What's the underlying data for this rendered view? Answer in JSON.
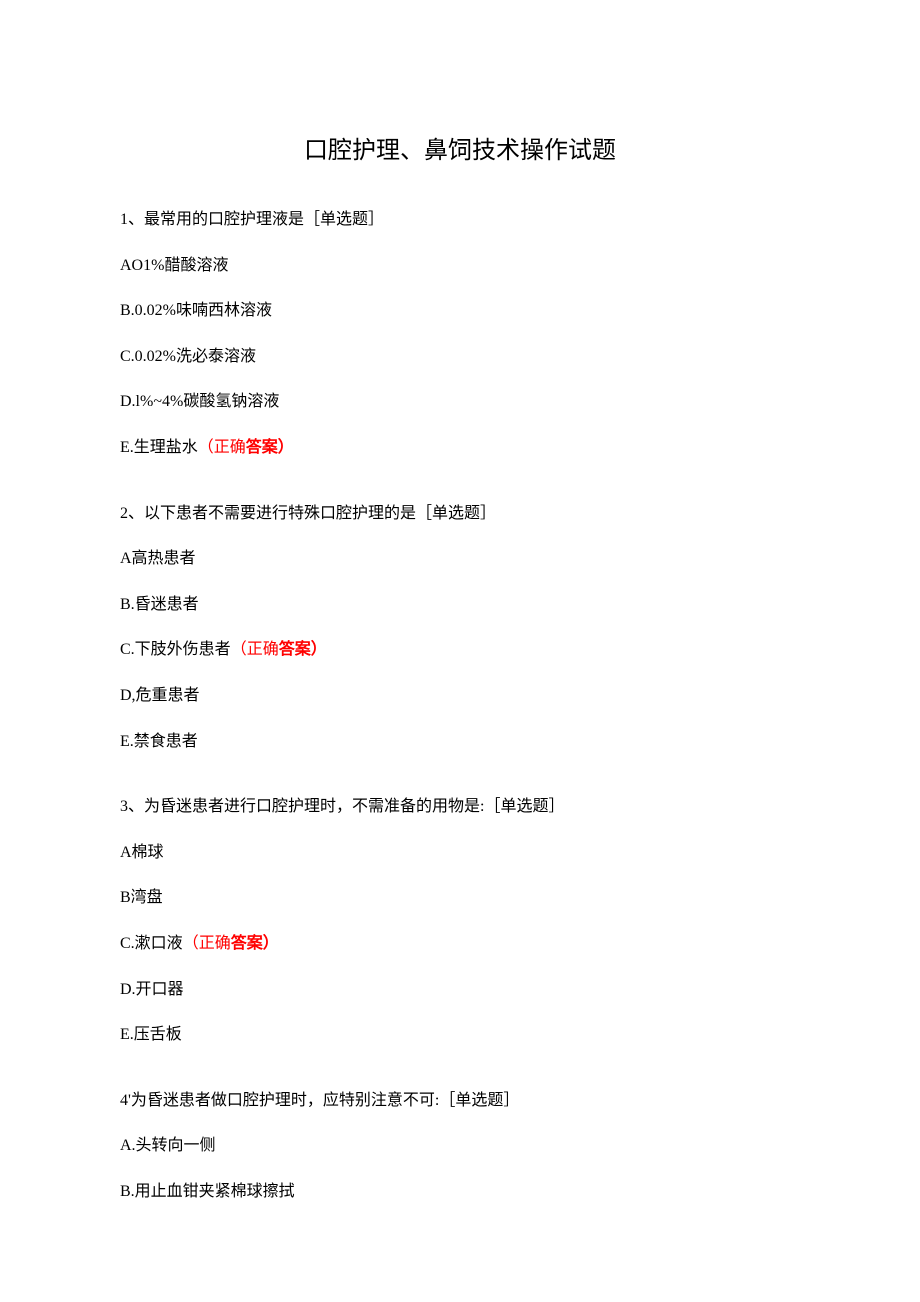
{
  "title": "口腔护理、鼻饲技术操作试题",
  "questions": [
    {
      "text": "1、最常用的口腔护理液是［单选题］",
      "options": [
        {
          "prefix": "AO1%醋酸溶液",
          "correct": ""
        },
        {
          "prefix": "B.0.02%味喃西林溶液",
          "correct": ""
        },
        {
          "prefix": "C.0.02%洗必泰溶液",
          "correct": ""
        },
        {
          "prefix": "D.l%~4%碳酸氢钠溶液",
          "correct": ""
        },
        {
          "prefix": "E.生理盐水",
          "correct_prefix": "（正确",
          "correct_bold": "答案）"
        }
      ]
    },
    {
      "text": "2、以下患者不需要进行特殊口腔护理的是［单选题］",
      "options": [
        {
          "prefix": "A高热患者",
          "correct": ""
        },
        {
          "prefix": "B.昏迷患者",
          "correct": ""
        },
        {
          "prefix": "C.下肢外伤患者",
          "correct_prefix": "（正确",
          "correct_bold": "答案）"
        },
        {
          "prefix": "D,危重患者",
          "correct": ""
        },
        {
          "prefix": "E.禁食患者",
          "correct": ""
        }
      ]
    },
    {
      "text": "3、为昏迷患者进行口腔护理时，不需准备的用物是:［单选题］",
      "options": [
        {
          "prefix": "A棉球",
          "correct": ""
        },
        {
          "prefix": "B湾盘",
          "correct": ""
        },
        {
          "prefix": "C.漱口液",
          "correct_prefix": "（正确",
          "correct_bold": "答案）"
        },
        {
          "prefix": "D.开口器",
          "correct": ""
        },
        {
          "prefix": "E.压舌板",
          "correct": ""
        }
      ]
    },
    {
      "text": "4'为昏迷患者做口腔护理时，应特别注意不可:［单选题］",
      "options": [
        {
          "prefix": "A.头转向一侧",
          "correct": ""
        },
        {
          "prefix": "B.用止血钳夹紧棉球擦拭",
          "correct": ""
        }
      ]
    }
  ]
}
